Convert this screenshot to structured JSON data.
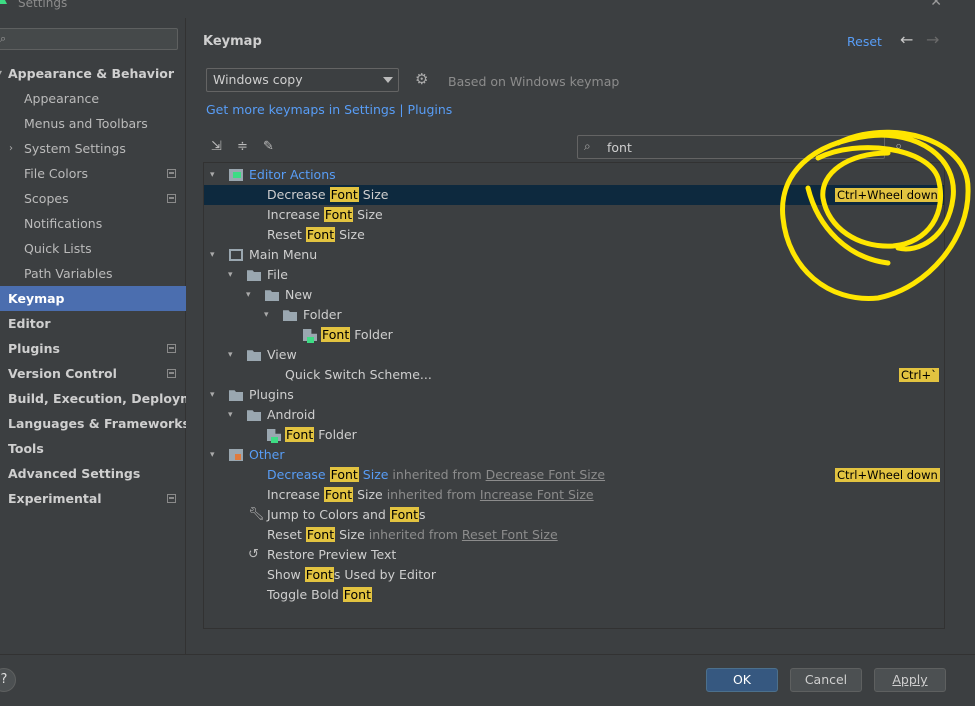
{
  "window": {
    "title": "Settings",
    "close_glyph": "✕"
  },
  "sidebar": {
    "search_placeholder": "",
    "items": [
      {
        "label": "Appearance & Behavior",
        "bold": true,
        "expanded": true
      },
      {
        "label": "Appearance"
      },
      {
        "label": "Menus and Toolbars"
      },
      {
        "label": "System Settings",
        "collapsible": true
      },
      {
        "label": "File Colors",
        "badge": true
      },
      {
        "label": "Scopes",
        "badge": true
      },
      {
        "label": "Notifications"
      },
      {
        "label": "Quick Lists"
      },
      {
        "label": "Path Variables"
      },
      {
        "label": "Keymap",
        "bold": true,
        "selected": true
      },
      {
        "label": "Editor",
        "bold": true
      },
      {
        "label": "Plugins",
        "bold": true,
        "badge": true
      },
      {
        "label": "Version Control",
        "bold": true,
        "badge": true
      },
      {
        "label": "Build, Execution, Deployment",
        "bold": true
      },
      {
        "label": "Languages & Frameworks",
        "bold": true
      },
      {
        "label": "Tools",
        "bold": true
      },
      {
        "label": "Advanced Settings",
        "bold": true
      },
      {
        "label": "Experimental",
        "bold": true,
        "badge": true
      }
    ]
  },
  "main": {
    "title": "Keymap",
    "reset_label": "Reset",
    "keymap_select": "Windows copy",
    "based_on": "Based on Windows keymap",
    "get_more": "Get more keymaps in Settings | Plugins",
    "filter_value": "font"
  },
  "tree": {
    "rows": [
      {
        "parts": [
          {
            "t": "Editor Actions"
          }
        ]
      },
      {
        "parts": [
          {
            "t": "Decrease "
          },
          {
            "t": "Font",
            "hl": true
          },
          {
            "t": " Size"
          }
        ],
        "shortcut": "Ctrl+Wheel down",
        "selected": true
      },
      {
        "parts": [
          {
            "t": "Increase "
          },
          {
            "t": "Font",
            "hl": true
          },
          {
            "t": " Size"
          }
        ]
      },
      {
        "parts": [
          {
            "t": "Reset "
          },
          {
            "t": "Font",
            "hl": true
          },
          {
            "t": " Size"
          }
        ]
      },
      {
        "parts": [
          {
            "t": "Main Menu"
          }
        ]
      },
      {
        "parts": [
          {
            "t": "File"
          }
        ]
      },
      {
        "parts": [
          {
            "t": "New"
          }
        ]
      },
      {
        "parts": [
          {
            "t": "Folder"
          }
        ]
      },
      {
        "parts": [
          {
            "t": "Font",
            "hl": true
          },
          {
            "t": " Folder"
          }
        ]
      },
      {
        "parts": [
          {
            "t": "View"
          }
        ]
      },
      {
        "parts": [
          {
            "t": "Quick Switch Scheme..."
          }
        ],
        "shortcut": "Ctrl+`"
      },
      {
        "parts": [
          {
            "t": "Plugins"
          }
        ]
      },
      {
        "parts": [
          {
            "t": "Android"
          }
        ]
      },
      {
        "parts": [
          {
            "t": "Font",
            "hl": true
          },
          {
            "t": " Folder"
          }
        ]
      },
      {
        "parts": [
          {
            "t": "Other"
          }
        ]
      },
      {
        "parts": [
          {
            "t": "Decrease "
          },
          {
            "t": "Font",
            "hl": true
          },
          {
            "t": " Size"
          },
          {
            "t": " inherited from ",
            "inh": true
          },
          {
            "t": "Decrease Font Size",
            "inh": true,
            "link": true
          }
        ],
        "shortcut": "Ctrl+Wheel down"
      },
      {
        "parts": [
          {
            "t": "Increase "
          },
          {
            "t": "Font",
            "hl": true
          },
          {
            "t": " Size"
          },
          {
            "t": " inherited from ",
            "inh": true
          },
          {
            "t": "Increase Font Size",
            "inh": true,
            "link": true
          }
        ]
      },
      {
        "parts": [
          {
            "t": "Jump to Colors and "
          },
          {
            "t": "Font",
            "hl": true
          },
          {
            "t": "s"
          }
        ]
      },
      {
        "parts": [
          {
            "t": "Reset "
          },
          {
            "t": "Font",
            "hl": true
          },
          {
            "t": " Size"
          },
          {
            "t": " inherited from ",
            "inh": true
          },
          {
            "t": "Reset Font Size",
            "inh": true,
            "link": true
          }
        ]
      },
      {
        "parts": [
          {
            "t": "Restore Preview Text"
          }
        ]
      },
      {
        "parts": [
          {
            "t": "Show "
          },
          {
            "t": "Font",
            "hl": true
          },
          {
            "t": "s Used by Editor"
          }
        ]
      },
      {
        "parts": [
          {
            "t": "Toggle Bold "
          },
          {
            "t": "Font",
            "hl": true
          }
        ]
      }
    ]
  },
  "buttons": {
    "help": "?",
    "ok": "OK",
    "cancel": "Cancel",
    "apply": "Apply"
  },
  "colors": {
    "accent": "#589df6",
    "selection": "#4b6eaf",
    "highlight": "#e2c340",
    "annotation": "#ffe600"
  },
  "icons": [
    "app-icon",
    "search-icon",
    "gear-icon",
    "back-arrow-icon",
    "forward-arrow-icon",
    "expand-all-icon",
    "collapse-all-icon",
    "edit-icon",
    "find-shortcut-icon",
    "folder-icon",
    "wrench-icon",
    "undo-icon"
  ]
}
